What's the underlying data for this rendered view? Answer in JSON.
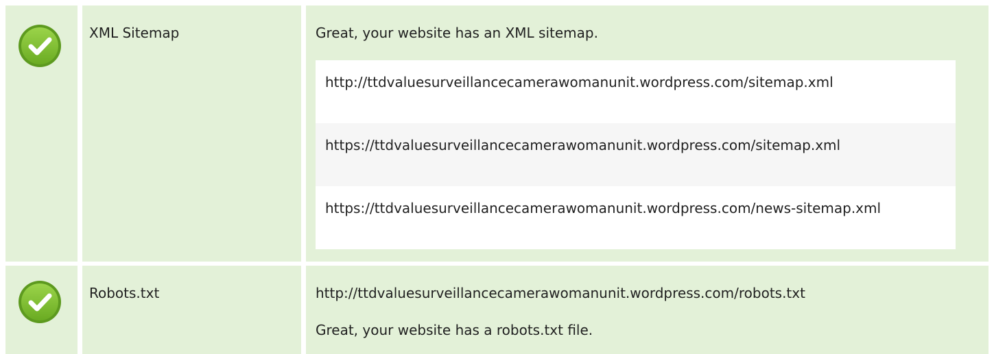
{
  "colors": {
    "row_bg": "#e3f1d8",
    "check_fill": "#7bbf2f",
    "check_border": "#5d9a1f",
    "text": "#1f1f1f"
  },
  "sitemap": {
    "icon": "check-circle-icon",
    "label": "XML Sitemap",
    "status": "Great, your website has an XML sitemap.",
    "urls": [
      "http://ttdvaluesurveillancecamerawomanunit.wordpress.com/sitemap.xml",
      "https://ttdvaluesurveillancecamerawomanunit.wordpress.com/sitemap.xml",
      "https://ttdvaluesurveillancecamerawomanunit.wordpress.com/news-sitemap.xml"
    ]
  },
  "robots": {
    "icon": "check-circle-icon",
    "label": "Robots.txt",
    "url": "http://ttdvaluesurveillancecamerawomanunit.wordpress.com/robots.txt",
    "status": "Great, your website has a robots.txt file."
  }
}
